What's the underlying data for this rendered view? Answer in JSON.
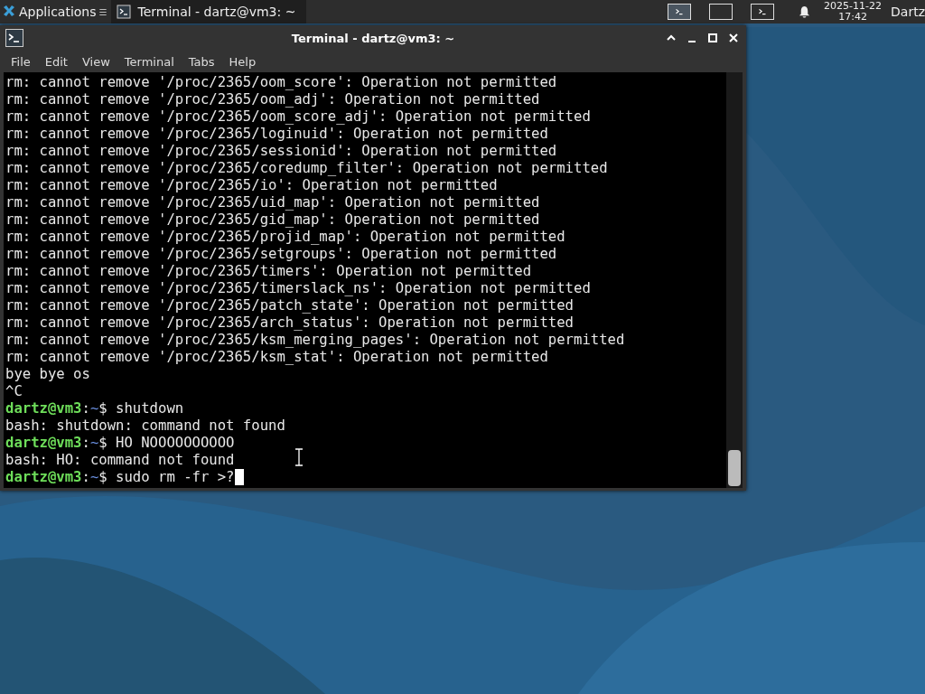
{
  "panel": {
    "applications_label": "Applications",
    "applications_glyph": "☰",
    "tasks": [
      {
        "title": "Terminal - dartz@vm3: ~",
        "selected": true
      }
    ],
    "workspaces": [
      {
        "selected": true,
        "has_window": true
      },
      {
        "selected": false,
        "has_window": false
      },
      {
        "selected": false,
        "has_window": true
      }
    ],
    "clock": {
      "date": "2025-11-22",
      "time": "17:42"
    },
    "user": "Dartz"
  },
  "window": {
    "title": "Terminal - dartz@vm3: ~",
    "menu": [
      "File",
      "Edit",
      "View",
      "Terminal",
      "Tabs",
      "Help"
    ],
    "lines": [
      {
        "kind": "output",
        "text": "rm: cannot remove '/proc/2365/oom_score': Operation not permitted"
      },
      {
        "kind": "output",
        "text": "rm: cannot remove '/proc/2365/oom_adj': Operation not permitted"
      },
      {
        "kind": "output",
        "text": "rm: cannot remove '/proc/2365/oom_score_adj': Operation not permitted"
      },
      {
        "kind": "output",
        "text": "rm: cannot remove '/proc/2365/loginuid': Operation not permitted"
      },
      {
        "kind": "output",
        "text": "rm: cannot remove '/proc/2365/sessionid': Operation not permitted"
      },
      {
        "kind": "output",
        "text": "rm: cannot remove '/proc/2365/coredump_filter': Operation not permitted"
      },
      {
        "kind": "output",
        "text": "rm: cannot remove '/proc/2365/io': Operation not permitted"
      },
      {
        "kind": "output",
        "text": "rm: cannot remove '/proc/2365/uid_map': Operation not permitted"
      },
      {
        "kind": "output",
        "text": "rm: cannot remove '/proc/2365/gid_map': Operation not permitted"
      },
      {
        "kind": "output",
        "text": "rm: cannot remove '/proc/2365/projid_map': Operation not permitted"
      },
      {
        "kind": "output",
        "text": "rm: cannot remove '/proc/2365/setgroups': Operation not permitted"
      },
      {
        "kind": "output",
        "text": "rm: cannot remove '/proc/2365/timers': Operation not permitted"
      },
      {
        "kind": "output",
        "text": "rm: cannot remove '/proc/2365/timerslack_ns': Operation not permitted"
      },
      {
        "kind": "output",
        "text": "rm: cannot remove '/proc/2365/patch_state': Operation not permitted"
      },
      {
        "kind": "output",
        "text": "rm: cannot remove '/proc/2365/arch_status': Operation not permitted"
      },
      {
        "kind": "output",
        "text": "rm: cannot remove '/proc/2365/ksm_merging_pages': Operation not permitted"
      },
      {
        "kind": "output",
        "text": "rm: cannot remove '/proc/2365/ksm_stat': Operation not permitted"
      },
      {
        "kind": "output",
        "text": "bye bye os"
      },
      {
        "kind": "output",
        "text": "^C"
      },
      {
        "kind": "prompt",
        "user": "dartz@vm3",
        "sep": ":",
        "path": "~",
        "sign": "$",
        "command": "shutdown"
      },
      {
        "kind": "output",
        "text": "bash: shutdown: command not found"
      },
      {
        "kind": "prompt",
        "user": "dartz@vm3",
        "sep": ":",
        "path": "~",
        "sign": "$",
        "command": "HO NOOOOOOOOOO"
      },
      {
        "kind": "output",
        "text": "bash: HO: command not found"
      },
      {
        "kind": "prompt",
        "user": "dartz@vm3",
        "sep": ":",
        "path": "~",
        "sign": "$",
        "command": "sudo rm -fr >?",
        "cursor": true
      }
    ]
  }
}
